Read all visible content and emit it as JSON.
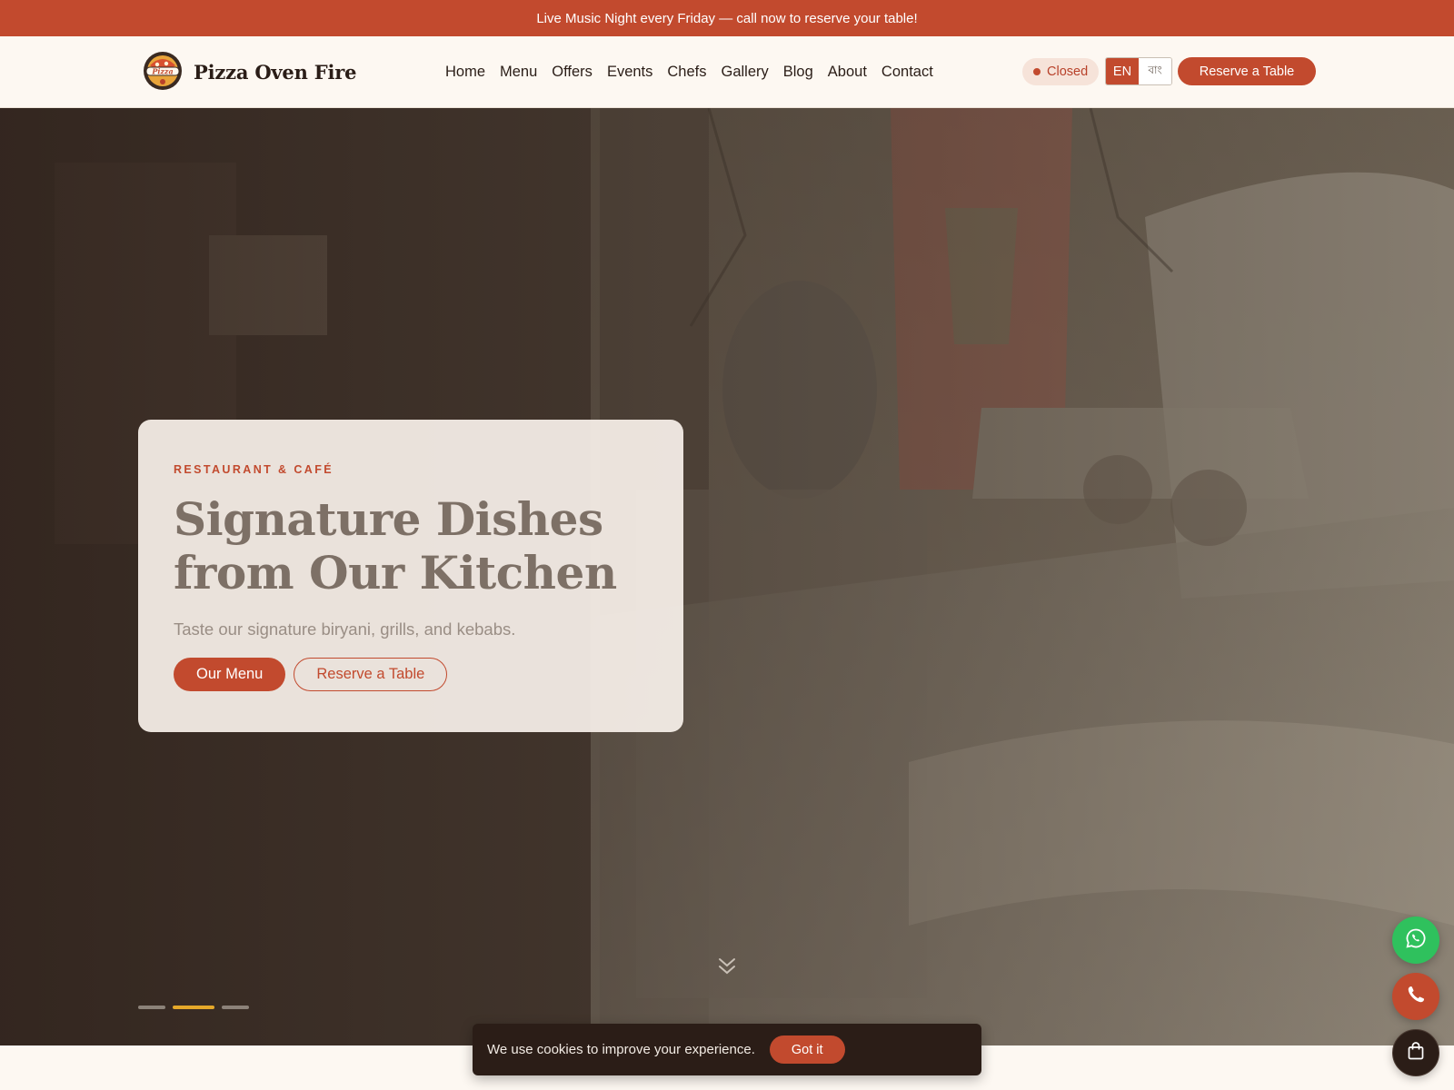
{
  "announcement": {
    "text": "Live Music Night every Friday — call now to reserve your table!"
  },
  "header": {
    "brand_name": "Pizza Oven Fire",
    "logo_text": "Pizza",
    "nav": [
      "Home",
      "Menu",
      "Offers",
      "Events",
      "Chefs",
      "Gallery",
      "Blog",
      "About",
      "Contact"
    ],
    "status": "Closed",
    "languages": {
      "active": "EN",
      "inactive": "বাং"
    },
    "cta": "Reserve a Table"
  },
  "hero": {
    "eyebrow": "RESTAURANT & CAFÉ",
    "title_line1": "Signature Dishes",
    "title_line2": "from Our Kitchen",
    "subtitle": "Taste our signature biryani, grills, and kebabs.",
    "primary_button": "Our Menu",
    "secondary_button": "Reserve a Table",
    "slides": {
      "count": 3,
      "active_index": 1
    }
  },
  "cookie_banner": {
    "text": "We use cookies to improve your experience.",
    "button": "Got it"
  },
  "floating_actions": {
    "icons": [
      "whatsapp-icon",
      "phone-icon",
      "shopping-bag-icon"
    ]
  },
  "colors": {
    "brand": "#c24a2e",
    "dark": "#2b1d17",
    "whatsapp": "#2fc15d",
    "slide_active": "#e5a82a",
    "cream": "#fdf8f2"
  }
}
